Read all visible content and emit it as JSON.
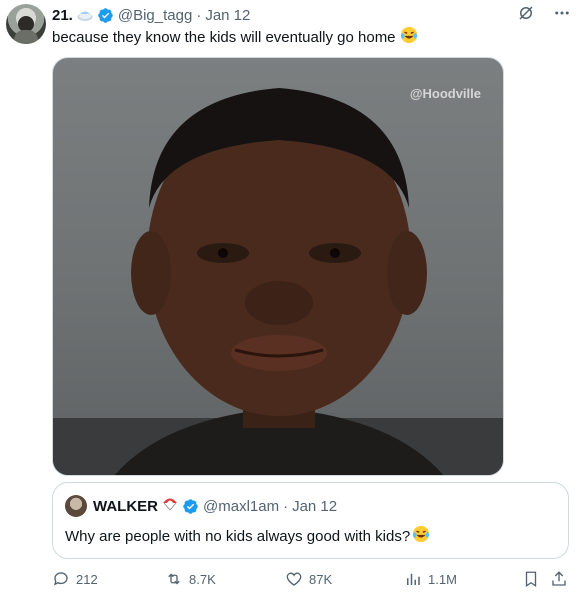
{
  "author": {
    "display_name": "21.",
    "name_emoji": "plate-emoji",
    "handle": "@Big_tagg",
    "separator": "·",
    "date": "Jan 12"
  },
  "tweet": {
    "text": "because they know the kids will eventually go home",
    "emoji": "laughing-tears-emoji"
  },
  "media": {
    "watermark": "@Hoodville"
  },
  "quote": {
    "display_name": "WALKER",
    "name_emoji": "parachute-emoji",
    "handle": "@maxl1am",
    "separator": "·",
    "date": "Jan 12",
    "text": "Why are people with no kids always good with kids?",
    "emoji": "laughing-tears-emoji"
  },
  "actions": {
    "replies": "212",
    "retweets": "8.7K",
    "likes": "87K",
    "views": "1.1M"
  },
  "colors": {
    "verified": "#1d9bf0",
    "muted_text": "#536471",
    "border": "#cfd9de"
  }
}
